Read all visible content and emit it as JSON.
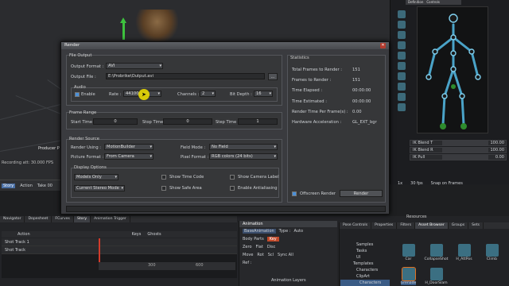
{
  "viewport": {
    "producer_label": "Producer P",
    "recording": "Recording att: 30.000 FPS"
  },
  "right_panel": {
    "tabs": [
      "Definition",
      "Controls"
    ],
    "props": [
      {
        "k": "IK Blend T",
        "v": "100.00"
      },
      {
        "k": "IK Blend R",
        "v": "100.00"
      },
      {
        "k": "IK Pull",
        "v": "0.00"
      }
    ]
  },
  "transport": {
    "left": [
      "Story",
      "Action",
      "Take 00"
    ],
    "right": [
      "1x",
      "30 fps",
      "Snap on Frames"
    ]
  },
  "bottom_tabs": [
    "Navigator",
    "Dopesheet",
    "FCurves",
    "Story",
    "Animation Trigger"
  ],
  "story_toolbar": {
    "left": "Action",
    "keys": "Keys",
    "ghosts": "Ghosts"
  },
  "tracks": [
    "Shot Track 1",
    "Shot Track"
  ],
  "ruler": [
    "300",
    "600"
  ],
  "anim_panel": {
    "title": "Animation",
    "type_label": "Type :",
    "type_value": "Auto",
    "base": "BaseAnimation",
    "key": "Key",
    "body_parts": "Body Parts",
    "row1": [
      "Zero",
      "Flat",
      "Disc"
    ],
    "row2": [
      "Move",
      "Rot",
      "Scl"
    ],
    "row3": [
      "Sync All"
    ],
    "ref": "Ref :",
    "footer": "Animation Layers"
  },
  "pose_tabs": [
    "Pose Controls",
    "Properties",
    "Filters",
    "Asset Browser",
    "Groups",
    "Sets"
  ],
  "resources_label": "Resources",
  "asset_tree": [
    "Samples",
    "Tasks",
    "UI",
    "Templates",
    "Characters",
    "ClipArt",
    "Characters"
  ],
  "assets": [
    "Car",
    "CollapseShot",
    "H_AttPos",
    "Climb",
    "Grenade",
    "H_DoorSlam"
  ],
  "dialog": {
    "title": "Render",
    "file_output": "File Output",
    "output_format_label": "Output Format :",
    "output_format": "AVI",
    "output_file_label": "Output File :",
    "output_file": "E:\\Probrike\\Output.avi",
    "browse": "...",
    "audio": "Audio",
    "enable": "Enable",
    "rate_label": "Rate :",
    "rate": "44100",
    "channels_label": "Channels :",
    "channels": "2",
    "bitdepth_label": "Bit Depth :",
    "bitdepth": "16",
    "frame_range": "Frame Range",
    "start_label": "Start Time :",
    "start": "0",
    "stop_label": "Stop Time :",
    "stop": "0",
    "step_label": "Step Time :",
    "step": "1",
    "render_source": "Render Source",
    "render_using_label": "Render Using :",
    "render_using": "MotionBuilder",
    "field_mode_label": "Field Mode :",
    "field_mode": "No Field",
    "picture_format_label": "Picture Format :",
    "picture_format": "From Camera",
    "pixel_format_label": "Pixel Format :",
    "pixel_format": "RGB colors (24 bits)",
    "display_options": "Display Options",
    "models_only": "Models Only",
    "show_time_code": "Show Time Code",
    "show_camera_label": "Show Camera Label",
    "stereo_mode": "Current Stereo Mode",
    "show_safe_area": "Show Safe Area",
    "enable_antialiasing": "Enable Antialiasing",
    "statistics": "Statistics",
    "stats": [
      {
        "k": "Total Frames to Render :",
        "v": "151"
      },
      {
        "k": "Frames to Render :",
        "v": "151"
      },
      {
        "k": "Time Elapsed :",
        "v": "00:00:00"
      },
      {
        "k": "Time Estimated :",
        "v": "00:00:00"
      },
      {
        "k": "Render Time Per Frame(s) :",
        "v": "0.00"
      },
      {
        "k": "Hardware Acceleration :",
        "v": "GL_EXT_bgr"
      }
    ],
    "offscreen": "Offscreen Render",
    "render_button": "Render"
  }
}
